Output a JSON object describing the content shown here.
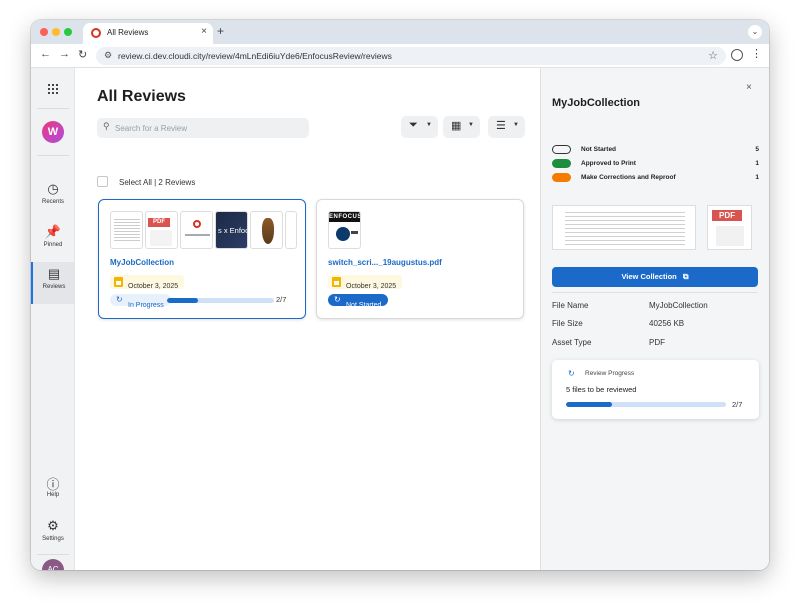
{
  "browser": {
    "tab_title": "All Reviews",
    "tab_close": "×",
    "new_tab": "+",
    "tab_menu": "⌄",
    "url": "review.ci.dev.cloudi.city/review/4mLnEdi6iuYde6/EnfocusReview/reviews"
  },
  "rail": {
    "logo_letter": "W",
    "items": [
      {
        "label": "Recents",
        "icon": "clock-icon"
      },
      {
        "label": "Pinned",
        "icon": "pin-icon"
      },
      {
        "label": "Reviews",
        "icon": "document-icon"
      },
      {
        "label": "Help",
        "icon": "help-icon"
      },
      {
        "label": "Settings",
        "icon": "gear-icon"
      }
    ],
    "avatar_initials": "AC"
  },
  "main": {
    "title": "All Reviews",
    "search_placeholder": "Search for a Review",
    "select_all_label": "Select All | 2 Reviews",
    "cards": [
      {
        "title": "MyJobCollection",
        "date": "October 3, 2025",
        "status": "In Progress",
        "progress_fraction": 0.2857,
        "count": "2/7",
        "thumb_pdf_label": "PDF",
        "thumb_dark_text": "s x Enfocus"
      },
      {
        "title": "switch_scri..._19augustus.pdf",
        "date": "October 3, 2025",
        "status": "Not Started",
        "thumb_brand": "ENFOCUS"
      }
    ]
  },
  "panel": {
    "title": "MyJobCollection",
    "close": "×",
    "legend": [
      {
        "label": "Not Started",
        "count": "5",
        "color": "#ffffff"
      },
      {
        "label": "Approved to Print",
        "count": "1",
        "color": "#1e8e3e"
      },
      {
        "label": "Make Corrections and Reproof",
        "count": "1",
        "color": "#f57c00"
      }
    ],
    "preview_pdf_label": "PDF",
    "view_button": "View Collection",
    "meta": [
      {
        "key": "File Name",
        "value": "MyJobCollection"
      },
      {
        "key": "File Size",
        "value": "40256 KB"
      },
      {
        "key": "Asset Type",
        "value": "PDF"
      }
    ],
    "progress": {
      "title": "Review Progress",
      "subtitle": "5 files to be reviewed",
      "fraction": 0.2857,
      "count": "2/7"
    }
  },
  "colors": {
    "accent": "#1b6ac9",
    "approved": "#1e8e3e",
    "corrections": "#f57c00"
  }
}
